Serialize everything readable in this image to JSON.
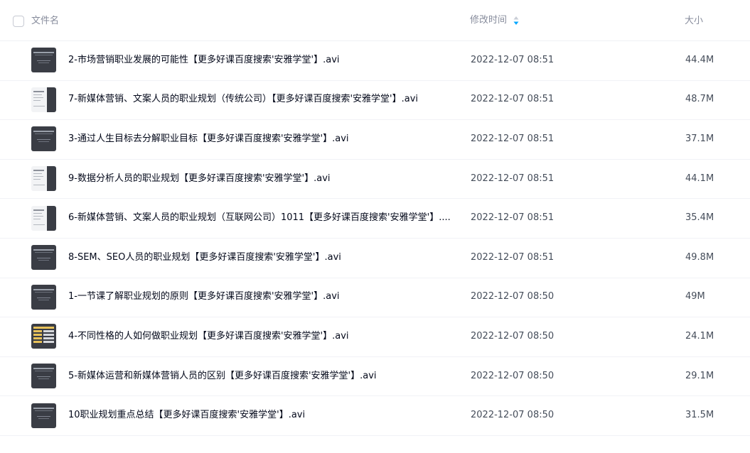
{
  "header": {
    "name_label": "文件名",
    "time_label": "修改时间",
    "size_label": "大小"
  },
  "colors": {
    "sort_accent": "#06a7ff",
    "text_primary": "#03081a",
    "text_secondary": "#878c9c"
  },
  "files": [
    {
      "name": "2-市场营销职业发展的可能性【更多好课百度搜索'安雅学堂'】.avi",
      "time": "2022-12-07 08:51",
      "size": "44.4M",
      "thumb": "dark"
    },
    {
      "name": "7-新媒体营销、文案人员的职业规划（传统公司）【更多好课百度搜索'安雅学堂'】.avi",
      "time": "2022-12-07 08:51",
      "size": "48.7M",
      "thumb": "light"
    },
    {
      "name": "3-通过人生目标去分解职业目标【更多好课百度搜索'安雅学堂'】.avi",
      "time": "2022-12-07 08:51",
      "size": "37.1M",
      "thumb": "dark"
    },
    {
      "name": "9-数据分析人员的职业规划【更多好课百度搜索'安雅学堂'】.avi",
      "time": "2022-12-07 08:51",
      "size": "44.1M",
      "thumb": "light"
    },
    {
      "name": "6-新媒体营销、文案人员的职业规划（互联网公司）1011【更多好课百度搜索'安雅学堂'】....",
      "time": "2022-12-07 08:51",
      "size": "35.4M",
      "thumb": "light"
    },
    {
      "name": "8-SEM、SEO人员的职业规划【更多好课百度搜索'安雅学堂'】.avi",
      "time": "2022-12-07 08:51",
      "size": "49.8M",
      "thumb": "dark"
    },
    {
      "name": "1-一节课了解职业规划的原则【更多好课百度搜索'安雅学堂'】.avi",
      "time": "2022-12-07 08:50",
      "size": "49M",
      "thumb": "dark"
    },
    {
      "name": "4-不同性格的人如何做职业规划【更多好课百度搜索'安雅学堂'】.avi",
      "time": "2022-12-07 08:50",
      "size": "24.1M",
      "thumb": "table"
    },
    {
      "name": "5-新媒体运营和新媒体营销人员的区别【更多好课百度搜索'安雅学堂'】.avi",
      "time": "2022-12-07 08:50",
      "size": "29.1M",
      "thumb": "dark"
    },
    {
      "name": "10职业规划重点总结【更多好课百度搜索'安雅学堂'】.avi",
      "time": "2022-12-07 08:50",
      "size": "31.5M",
      "thumb": "dark"
    }
  ]
}
